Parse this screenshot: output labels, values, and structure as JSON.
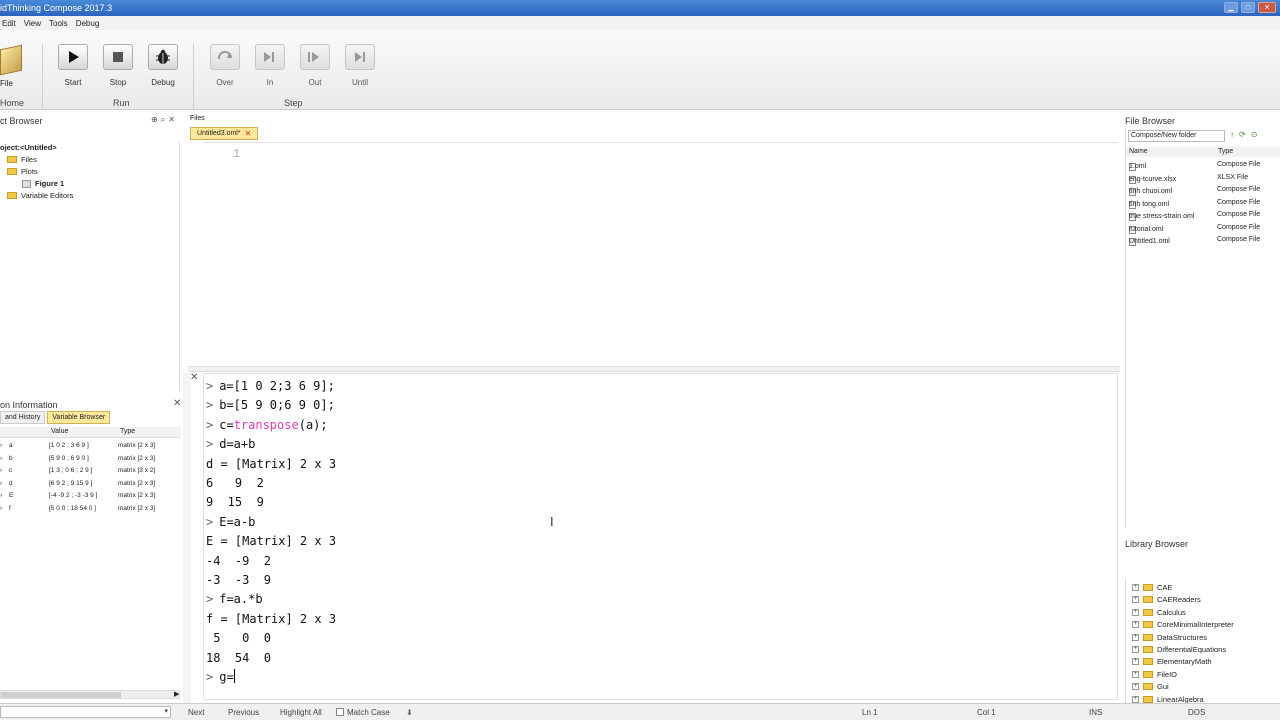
{
  "window": {
    "title": "idThinking Compose 2017.3"
  },
  "menu": [
    "Edit",
    "View",
    "Tools",
    "Debug"
  ],
  "ribbon": {
    "file_label": "File",
    "home_label": "Home",
    "run": {
      "group": "Run",
      "start": "Start",
      "stop": "Stop",
      "debug": "Debug"
    },
    "step": {
      "group": "Step",
      "over": "Over",
      "in": "In",
      "out": "Out",
      "until": "Until"
    }
  },
  "project_browser": {
    "title": "ct Browser",
    "root": "oject:<Untitled>",
    "items": [
      "Files",
      "Plots",
      "Figure 1",
      "Variable Editors"
    ]
  },
  "session": {
    "title": "on Information",
    "tabs": [
      "and History",
      "Variable Browser"
    ],
    "columns": [
      "Value",
      "Type"
    ],
    "vars": [
      {
        "name": "a",
        "value": "[1 0 2 ; 3 6 9 ]",
        "type": "matrix [2 x 3]"
      },
      {
        "name": "b",
        "value": "[5 9 0 ; 6 9 0 ]",
        "type": "matrix [2 x 3]"
      },
      {
        "name": "c",
        "value": "[1 3 ; 0 6 ; 2 9 ]",
        "type": "matrix [3 x 2]"
      },
      {
        "name": "d",
        "value": "[6 9 2 ; 9 15 9 ]",
        "type": "matrix [2 x 3]"
      },
      {
        "name": "E",
        "value": "[-4 -9 2 ; -3 -3 9 ]",
        "type": "matrix [2 x 3]"
      },
      {
        "name": "f",
        "value": "[5 0 0 ; 18 54 0 ]",
        "type": "matrix [2 x 3]"
      }
    ]
  },
  "editor": {
    "files_label": "Files",
    "tab": "Untitled3.oml*",
    "line_number": "1"
  },
  "console": {
    "lines": [
      {
        "prompt": ">",
        "pre": "a=[1 0 2;3 6 9];",
        "fn": "",
        "post": ""
      },
      {
        "prompt": ">",
        "pre": "b=[5 9 0;6 9 0];",
        "fn": "",
        "post": ""
      },
      {
        "prompt": ">",
        "pre": "c=",
        "fn": "transpose",
        "post": "(a);"
      },
      {
        "prompt": ">",
        "pre": "d=a+b",
        "fn": "",
        "post": ""
      },
      {
        "prompt": "",
        "pre": "d = [Matrix] 2 x 3",
        "fn": "",
        "post": ""
      },
      {
        "prompt": "",
        "pre": "6   9  2",
        "fn": "",
        "post": ""
      },
      {
        "prompt": "",
        "pre": "9  15  9",
        "fn": "",
        "post": ""
      },
      {
        "prompt": ">",
        "pre": "E=a-b",
        "fn": "",
        "post": ""
      },
      {
        "prompt": "",
        "pre": "E = [Matrix] 2 x 3",
        "fn": "",
        "post": ""
      },
      {
        "prompt": "",
        "pre": "-4  -9  2",
        "fn": "",
        "post": ""
      },
      {
        "prompt": "",
        "pre": "-3  -3  9",
        "fn": "",
        "post": ""
      },
      {
        "prompt": ">",
        "pre": "f=a.*b",
        "fn": "",
        "post": ""
      },
      {
        "prompt": "",
        "pre": "f = [Matrix] 2 x 3",
        "fn": "",
        "post": ""
      },
      {
        "prompt": "",
        "pre": " 5   0  0",
        "fn": "",
        "post": ""
      },
      {
        "prompt": "",
        "pre": "18  54  0",
        "fn": "",
        "post": ""
      }
    ],
    "input": {
      "prompt": ">",
      "text": "g="
    }
  },
  "file_browser": {
    "title": "File Browser",
    "path": "Compose/New folder",
    "columns": [
      "Name",
      "Type"
    ],
    "files": [
      {
        "name": "1.oml",
        "type": "Compose File"
      },
      {
        "name": "eng-tcurve.xlsx",
        "type": "XLSX File"
      },
      {
        "name": "tinh chuoi.oml",
        "type": "Compose File"
      },
      {
        "name": "tinh tong.oml",
        "type": "Compose File"
      },
      {
        "name": "true stress-strain.oml",
        "type": "Compose File"
      },
      {
        "name": "tutorial.oml",
        "type": "Compose File"
      },
      {
        "name": "Untitled1.oml",
        "type": "Compose File"
      }
    ]
  },
  "library_browser": {
    "title": "Library Browser",
    "items": [
      "CAE",
      "CAEReaders",
      "Calculus",
      "CoreMinimalInterpreter",
      "DataStructures",
      "DifferentialEquations",
      "ElementaryMath",
      "FileIO",
      "Gui",
      "LinearAlgebra"
    ]
  },
  "statusbar": {
    "next": "Next",
    "previous": "Previous",
    "highlight_all": "Highlight All",
    "match_case": "Match Case",
    "ln": "Ln 1",
    "col": "Col 1",
    "ins": "INS",
    "dos": "DOS"
  }
}
